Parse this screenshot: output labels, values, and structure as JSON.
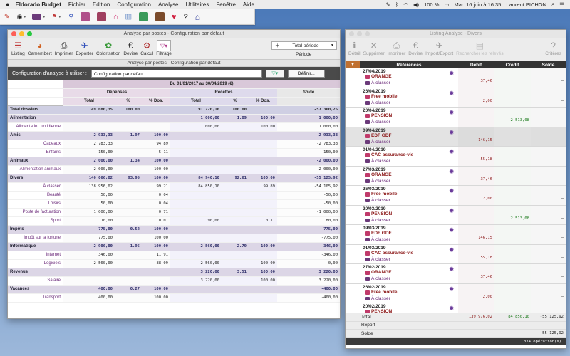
{
  "menubar": {
    "app": "Eldorado Budget",
    "items": [
      "Fichier",
      "Edition",
      "Configuration",
      "Analyse",
      "Utilitaires",
      "Fenêtre",
      "Aide"
    ],
    "battery": "100 %",
    "datetime": "Mar. 16 juin à 16:35",
    "user": "Laurent PICHON"
  },
  "main_window": {
    "title": "Analyse par postes - Configuration par défaut",
    "toolbar": [
      "Listing",
      "Camembert",
      "Imprimer",
      "Exporter",
      "Colorisation",
      "Devise",
      "Calcul",
      "Filtrage"
    ],
    "period_label": "Période",
    "period_value": "Total période",
    "subtitle": "Analyse par postes - Configuration par défaut",
    "config_label": "Configuration d'analyse à utiliser :",
    "config_value": "Configuration par défaut",
    "define_button": "Définir...",
    "period_header": "Du 01/01/2017 au 30/04/2019 (€)",
    "groups": {
      "dep": "Dépenses",
      "rec": "Recettes",
      "sol": "Solde"
    },
    "cols": [
      "Total",
      "%",
      "% Dos.",
      "Total",
      "%",
      "% Dos."
    ],
    "rows": [
      {
        "t": "tot",
        "label": "Total dossiers",
        "d": "149 080,35",
        "dp": "100.00",
        "dd": "",
        "r": "91 720,10",
        "rp": "100.00",
        "rd": "",
        "s": "-57 360,25"
      },
      {
        "t": "grp",
        "label": "Alimentation",
        "d": "",
        "dp": "",
        "dd": "",
        "r": "1 000,00",
        "rp": "1.09",
        "rd": "100.00",
        "s": "1 000,00"
      },
      {
        "t": "sub",
        "label": "Alimentatio...uotidienne",
        "d": "",
        "dp": "",
        "dd": "",
        "r": "1 000,00",
        "rp": "",
        "rd": "100.00",
        "s": "1 000,00"
      },
      {
        "t": "grp",
        "label": "Amis",
        "d": "2 933,33",
        "dp": "1.97",
        "dd": "100.00",
        "r": "",
        "rp": "",
        "rd": "",
        "s": "-2 933,33"
      },
      {
        "t": "sub",
        "label": "Cadeaux",
        "d": "2 783,33",
        "dp": "",
        "dd": "94.89",
        "r": "",
        "rp": "",
        "rd": "",
        "s": "-2 783,33"
      },
      {
        "t": "sub",
        "label": "Enfants",
        "d": "150,00",
        "dp": "",
        "dd": "5.11",
        "r": "",
        "rp": "",
        "rd": "",
        "s": "-150,00"
      },
      {
        "t": "grp",
        "label": "Animaux",
        "d": "2 000,00",
        "dp": "1.34",
        "dd": "100.00",
        "r": "",
        "rp": "",
        "rd": "",
        "s": "-2 000,00"
      },
      {
        "t": "sub",
        "label": "Alimentation animaux",
        "d": "2 000,00",
        "dp": "",
        "dd": "100.00",
        "r": "",
        "rp": "",
        "rd": "",
        "s": "-2 000,00"
      },
      {
        "t": "grp",
        "label": "Divers",
        "d": "140 066,02",
        "dp": "93.95",
        "dd": "100.00",
        "r": "84 940,10",
        "rp": "92.61",
        "rd": "100.00",
        "s": "-55 125,92"
      },
      {
        "t": "sub",
        "label": "À classer",
        "d": "138 956,02",
        "dp": "",
        "dd": "99.21",
        "r": "84 850,10",
        "rp": "",
        "rd": "99.89",
        "s": "-54 105,92"
      },
      {
        "t": "sub",
        "label": "Beauté",
        "d": "50,00",
        "dp": "",
        "dd": "0.04",
        "r": "",
        "rp": "",
        "rd": "",
        "s": "-50,00"
      },
      {
        "t": "sub",
        "label": "Loisirs",
        "d": "50,00",
        "dp": "",
        "dd": "0.04",
        "r": "",
        "rp": "",
        "rd": "",
        "s": "-50,00"
      },
      {
        "t": "sub",
        "label": "Poste de facturation",
        "d": "1 000,00",
        "dp": "",
        "dd": "0.71",
        "r": "",
        "rp": "",
        "rd": "",
        "s": "-1 000,00"
      },
      {
        "t": "sub",
        "label": "Sport",
        "d": "10,00",
        "dp": "",
        "dd": "0.01",
        "r": "90,00",
        "rp": "",
        "rd": "0.11",
        "s": "80,00"
      },
      {
        "t": "grp",
        "label": "Impôts",
        "d": "775,00",
        "dp": "0.52",
        "dd": "100.00",
        "r": "",
        "rp": "",
        "rd": "",
        "s": "-775,00"
      },
      {
        "t": "sub",
        "label": "Impôt sur la fortune",
        "d": "775,00",
        "dp": "",
        "dd": "100.00",
        "r": "",
        "rp": "",
        "rd": "",
        "s": "-775,00"
      },
      {
        "t": "grp",
        "label": "Informatique",
        "d": "2 906,00",
        "dp": "1.95",
        "dd": "100.00",
        "r": "2 560,00",
        "rp": "2.79",
        "rd": "100.00",
        "s": "-346,00"
      },
      {
        "t": "sub",
        "label": "Internet",
        "d": "346,00",
        "dp": "",
        "dd": "11.91",
        "r": "",
        "rp": "",
        "rd": "",
        "s": "-346,00"
      },
      {
        "t": "sub",
        "label": "Logiciels",
        "d": "2 560,00",
        "dp": "",
        "dd": "88.09",
        "r": "2 560,00",
        "rp": "",
        "rd": "100.00",
        "s": "0,00"
      },
      {
        "t": "grp",
        "label": "Revenus",
        "d": "",
        "dp": "",
        "dd": "",
        "r": "3 220,00",
        "rp": "3.51",
        "rd": "100.00",
        "s": "3 220,00"
      },
      {
        "t": "sub",
        "label": "Salaire",
        "d": "",
        "dp": "",
        "dd": "",
        "r": "3 220,00",
        "rp": "",
        "rd": "100.00",
        "s": "3 220,00"
      },
      {
        "t": "grp",
        "label": "Vacances",
        "d": "400,00",
        "dp": "0.27",
        "dd": "100.00",
        "r": "",
        "rp": "",
        "rd": "",
        "s": "-400,00"
      },
      {
        "t": "sub",
        "label": "Transport",
        "d": "400,00",
        "dp": "",
        "dd": "100.00",
        "r": "",
        "rp": "",
        "rd": "",
        "s": "-400,00"
      }
    ]
  },
  "list_window": {
    "title": "Listing Analyse - Divers",
    "toolbar": [
      "Détail",
      "Supprimer",
      "Imprimer",
      "Devise",
      "Import/Export",
      "Rechercher les relevés",
      "Critères"
    ],
    "cols": [
      "Références",
      "Débit",
      "Crédit",
      "Solde"
    ],
    "entries": [
      {
        "date": "27/04/2019",
        "name": "ORANGE",
        "cls": "À classer",
        "debit": "37,46",
        "credit": "",
        "solde": "–"
      },
      {
        "date": "26/04/2019",
        "name": "Free mobile",
        "cls": "À classer",
        "debit": "2,00",
        "credit": "",
        "solde": "–"
      },
      {
        "date": "20/04/2019",
        "name": "PENSION",
        "cls": "À classer",
        "debit": "",
        "credit": "2 513,08",
        "solde": "–"
      },
      {
        "date": "09/04/2019",
        "name": "EDF GDF",
        "cls": "À classer",
        "debit": "146,15",
        "credit": "",
        "solde": "–"
      },
      {
        "date": "01/04/2019",
        "name": "CAC assurance-vie",
        "cls": "À classer",
        "debit": "55,18",
        "credit": "",
        "solde": "–"
      },
      {
        "date": "27/03/2019",
        "name": "ORANGE",
        "cls": "À classer",
        "debit": "37,46",
        "credit": "",
        "solde": "–"
      },
      {
        "date": "26/03/2019",
        "name": "Free mobile",
        "cls": "À classer",
        "debit": "2,00",
        "credit": "",
        "solde": "–"
      },
      {
        "date": "20/03/2019",
        "name": "PENSION",
        "cls": "À classer",
        "debit": "",
        "credit": "2 513,08",
        "solde": "–"
      },
      {
        "date": "09/03/2019",
        "name": "EDF GDF",
        "cls": "À classer",
        "debit": "146,15",
        "credit": "",
        "solde": "–"
      },
      {
        "date": "01/03/2019",
        "name": "CAC assurance-vie",
        "cls": "À classer",
        "debit": "55,18",
        "credit": "",
        "solde": "–"
      },
      {
        "date": "27/02/2019",
        "name": "ORANGE",
        "cls": "À classer",
        "debit": "37,46",
        "credit": "",
        "solde": "–"
      },
      {
        "date": "26/02/2019",
        "name": "Free mobile",
        "cls": "À classer",
        "debit": "2,00",
        "credit": "",
        "solde": "–"
      },
      {
        "date": "20/02/2019",
        "name": "PENSION",
        "cls": "",
        "debit": "",
        "credit": "",
        "solde": ""
      }
    ],
    "footer": {
      "total_label": "Total",
      "total_debit": "139 976,02",
      "total_credit": "84 850,10",
      "total_solde": "-55 125,92",
      "report_label": "Report",
      "solde_label": "Solde",
      "solde_value": "-55 125,92",
      "count": "374 opération(s)"
    }
  }
}
